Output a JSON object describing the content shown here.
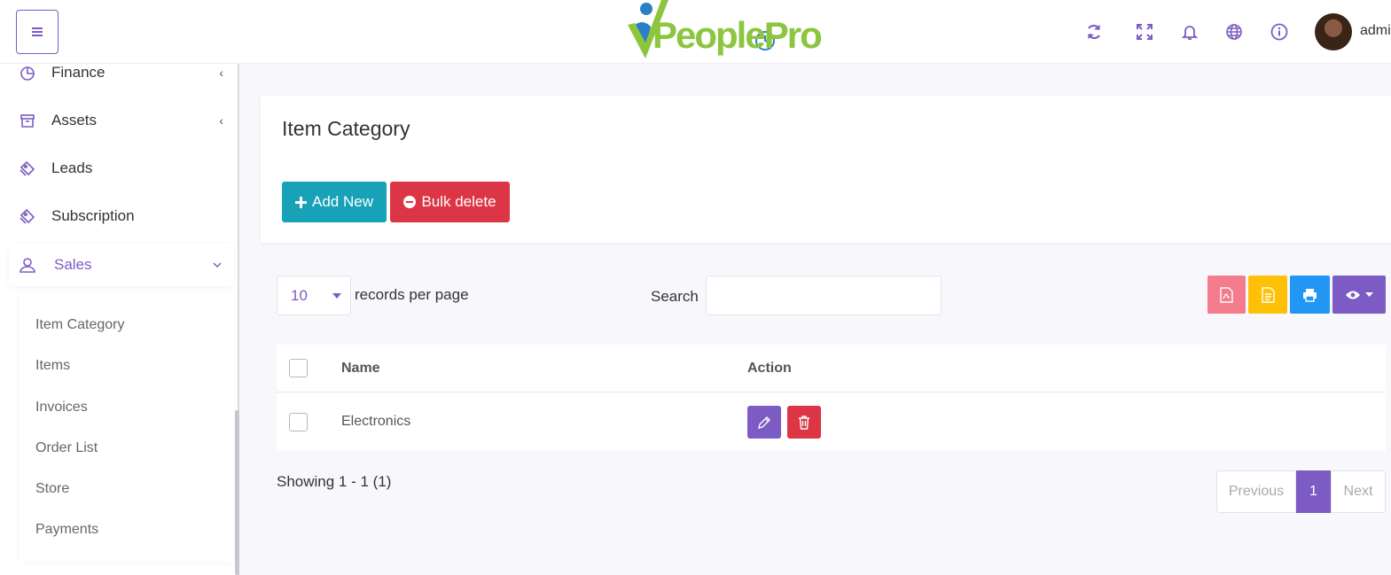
{
  "header": {
    "menu_icon": "hamburger-icon",
    "logo_text": "PeoplePro",
    "icons": [
      "refresh-icon",
      "fullscreen-icon",
      "bell-icon",
      "globe-icon",
      "info-icon"
    ],
    "username": "admi"
  },
  "sidebar": {
    "items": [
      {
        "label": "Finance",
        "icon": "pie-chart-icon",
        "chevron": "‹"
      },
      {
        "label": "Assets",
        "icon": "archive-icon",
        "chevron": "‹"
      },
      {
        "label": "Leads",
        "icon": "tag-icon"
      },
      {
        "label": "Subscription",
        "icon": "tag-icon"
      },
      {
        "label": "Sales",
        "icon": "user-icon",
        "chevron": "⌄",
        "active": true
      }
    ],
    "sales_submenu": [
      "Item Category",
      "Items",
      "Invoices",
      "Order List",
      "Store",
      "Payments"
    ]
  },
  "main": {
    "title": "Item Category",
    "add_new_label": "Add New",
    "bulk_delete_label": "Bulk delete",
    "length_value": "10",
    "length_label": "records per page",
    "search_label": "Search",
    "search_value": "",
    "toolbar_icons": [
      "pdf-icon",
      "csv-icon",
      "print-icon",
      "column-visibility-icon"
    ],
    "toolbar_colors": [
      "#f47c8c",
      "#ffc107",
      "#2196f3",
      "#7c5cc4"
    ]
  },
  "table": {
    "columns": [
      "Name",
      "Action"
    ],
    "rows": [
      {
        "name": "Electronics"
      }
    ]
  },
  "footer": {
    "info": "Showing 1 - 1 (1)",
    "previous_label": "Previous",
    "current_page": "1",
    "next_label": "Next"
  },
  "colors": {
    "accent": "#7c5cc4",
    "info": "#17a2b8",
    "danger": "#dc3545"
  }
}
